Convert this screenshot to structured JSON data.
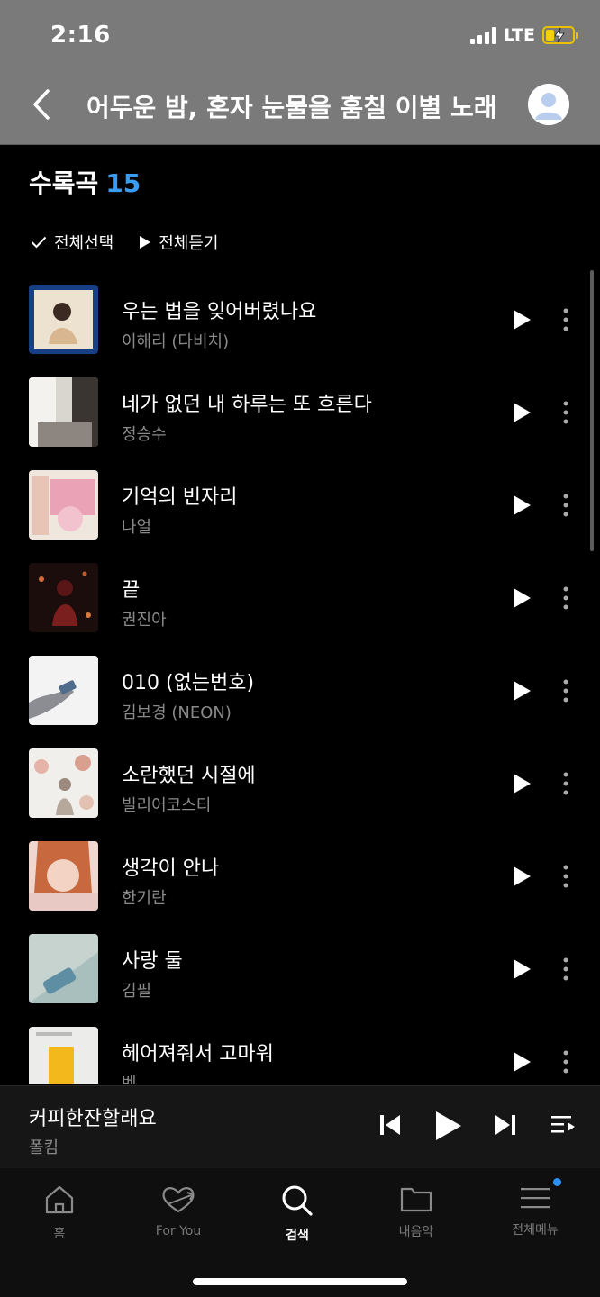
{
  "status": {
    "time": "2:16",
    "network": "LTE"
  },
  "header": {
    "title": "어두운 밤, 혼자 눈물을 훔칠 이별 노래"
  },
  "tracklist": {
    "label": "수록곡",
    "count": "15"
  },
  "actions": {
    "select_all": "전체선택",
    "play_all": "전체듣기"
  },
  "songs": [
    {
      "title": "우는 법을 잊어버렸나요",
      "artist": "이해리 (다비치)"
    },
    {
      "title": "네가 없던 내 하루는 또 흐른다",
      "artist": "정승수"
    },
    {
      "title": "기억의 빈자리",
      "artist": "나얼"
    },
    {
      "title": "끝",
      "artist": "권진아"
    },
    {
      "title": "010 (없는번호)",
      "artist": "김보경 (NEON)"
    },
    {
      "title": "소란했던 시절에",
      "artist": "빌리어코스티"
    },
    {
      "title": "생각이 안나",
      "artist": "한기란"
    },
    {
      "title": "사랑 둘",
      "artist": "김필"
    },
    {
      "title": "헤어져줘서 고마워",
      "artist": "벤"
    }
  ],
  "now_playing": {
    "title": "커피한잔할래요",
    "artist": "폴킴"
  },
  "tabs": [
    {
      "label": "홈",
      "icon": "home-icon"
    },
    {
      "label": "For You",
      "icon": "heart-arrow-icon"
    },
    {
      "label": "검색",
      "icon": "search-icon"
    },
    {
      "label": "내음악",
      "icon": "folder-icon"
    },
    {
      "label": "전체메뉴",
      "icon": "menu-icon"
    }
  ],
  "colors": {
    "accent": "#3a9cf0",
    "header_bg": "#7a7a7a",
    "badge_dot": "#2a8ff7"
  }
}
